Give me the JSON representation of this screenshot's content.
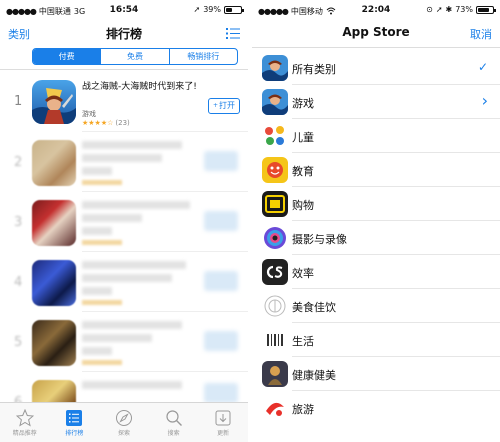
{
  "left": {
    "status": {
      "carrier": "中国联通",
      "network": "3G",
      "time": "16:54",
      "battery": "39%",
      "battery_level": 0.39
    },
    "nav": {
      "left_label": "类别",
      "title": "排行榜"
    },
    "segments": [
      {
        "label": "付费"
      },
      {
        "label": "免费"
      },
      {
        "label": "畅销排行"
      }
    ],
    "top_app": {
      "rank": "1",
      "name": "战之海贼-大海贼时代到来了!",
      "category": "游戏",
      "stars": "★★★★☆",
      "rating_count": "(23)",
      "button": "打开",
      "button_plus": "+"
    },
    "blurred_ranks": [
      "2",
      "3",
      "4",
      "5",
      "6"
    ],
    "tabs": [
      {
        "label": "精品推荐",
        "icon": "star-icon"
      },
      {
        "label": "排行榜",
        "icon": "list-icon"
      },
      {
        "label": "探索",
        "icon": "compass-icon"
      },
      {
        "label": "搜索",
        "icon": "search-icon"
      },
      {
        "label": "更新",
        "icon": "download-icon"
      }
    ]
  },
  "right": {
    "status": {
      "carrier": "中国移动",
      "time": "22:04",
      "battery": "73%",
      "battery_level": 0.73
    },
    "nav": {
      "title": "App Store",
      "right_label": "取消"
    },
    "categories": [
      {
        "label": "所有类别",
        "accessory": "checkmark"
      },
      {
        "label": "游戏",
        "accessory": "chevron"
      },
      {
        "label": "儿童"
      },
      {
        "label": "教育"
      },
      {
        "label": "购物"
      },
      {
        "label": "摄影与录像"
      },
      {
        "label": "效率"
      },
      {
        "label": "美食佳饮"
      },
      {
        "label": "生活"
      },
      {
        "label": "健康健美"
      },
      {
        "label": "旅游"
      }
    ]
  },
  "colors": {
    "accent": "#1a7fe8",
    "star": "#f5a623"
  }
}
